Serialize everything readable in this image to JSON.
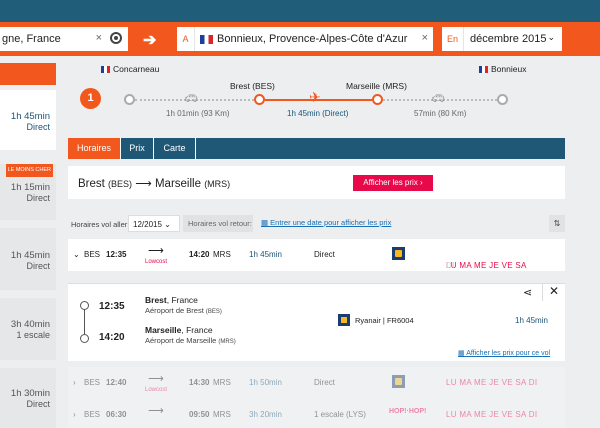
{
  "search": {
    "from_value": "gne, France",
    "to_tag": "A",
    "to_value": "Bonnieux, Provence-Alpes-Côte d'Azur",
    "date_tag": "En",
    "date_value": "décembre 2015",
    "clear_glyph": "×",
    "swap_glyph": "➔",
    "chevron_glyph": "⌄"
  },
  "left_results": [
    {
      "duration": "1h 45min",
      "type": "Direct",
      "badge": ""
    },
    {
      "duration": "1h 15min",
      "type": "Direct",
      "badge": "LE MOINS CHER"
    },
    {
      "duration": "1h 45min",
      "type": "Direct",
      "badge": ""
    },
    {
      "duration": "3h 40min",
      "type": "1 escale",
      "badge": ""
    },
    {
      "duration": "1h 30min",
      "type": "Direct",
      "badge": ""
    }
  ],
  "route": {
    "step_number": "1",
    "origin": "Concarneau",
    "stop1": "Brest (BES)",
    "stop2": "Marseille (MRS)",
    "destination": "Bonnieux",
    "leg1": "1h 01min (93 Km)",
    "leg2": "1h 45min (Direct)",
    "leg3": "57min (80 Km)"
  },
  "tabs": [
    "Horaires",
    "Prix",
    "Carte"
  ],
  "summary": {
    "from": "Brest",
    "from_code": "(BES)",
    "arrow": "⟶",
    "to": "Marseille",
    "to_code": "(MRS)",
    "button": "Afficher les prix ›"
  },
  "filter": {
    "outbound_label": "Horaires vol aller:",
    "outbound_value": "12/2015 ⌄",
    "return_label": "Horaires vol retour:",
    "date_link": "Entrer une date pour afficher les prix",
    "sort_glyph": "⇅"
  },
  "flights": [
    {
      "dep_code": "BES",
      "dep_time": "12:35",
      "arr_time": "14:20",
      "arr_code": "MRS",
      "duration": "1h 45min",
      "type": "Direct",
      "lowcost": "Lowcost",
      "days_on": "LU MA ME JE VE SA",
      "days_off": "DI",
      "chevron": "⌄",
      "arrow": "⟶"
    },
    {
      "dep_code": "BES",
      "dep_time": "12:40",
      "arr_time": "14:30",
      "arr_code": "MRS",
      "duration": "1h 50min",
      "type": "Direct",
      "lowcost": "Lowcost",
      "days_on": "LU MA ME JE VE SA DI",
      "days_off": "",
      "chevron": "›",
      "arrow": "⟶"
    },
    {
      "dep_code": "BES",
      "dep_time": "06:30",
      "arr_time": "09:50",
      "arr_code": "MRS",
      "duration": "3h 20min",
      "type": "1 escale (LYS)",
      "lowcost": "",
      "days_on": "LU MA ME JE VE SA DI",
      "days_off": "",
      "chevron": "›",
      "arrow": "⟶",
      "airline_text": "HOP!·HOP!"
    }
  ],
  "detail": {
    "dep_time": "12:35",
    "dep_city": "Brest",
    "dep_country": ", France",
    "dep_airport": "Aéroport de Brest",
    "dep_code": "(BES)",
    "arr_time": "14:20",
    "arr_city": "Marseille",
    "arr_country": ", France",
    "arr_airport": "Aéroport de Marseille",
    "arr_code": "(MRS)",
    "carrier": "Ryanair | FR6004",
    "duration": "1h 45min",
    "share_glyph": "⋖",
    "close_glyph": "✕",
    "prices_link": "Afficher les prix pour ce vol"
  },
  "colors": {
    "accent": "#f2571d",
    "nav": "#1e5876",
    "cta": "#e8094a"
  }
}
